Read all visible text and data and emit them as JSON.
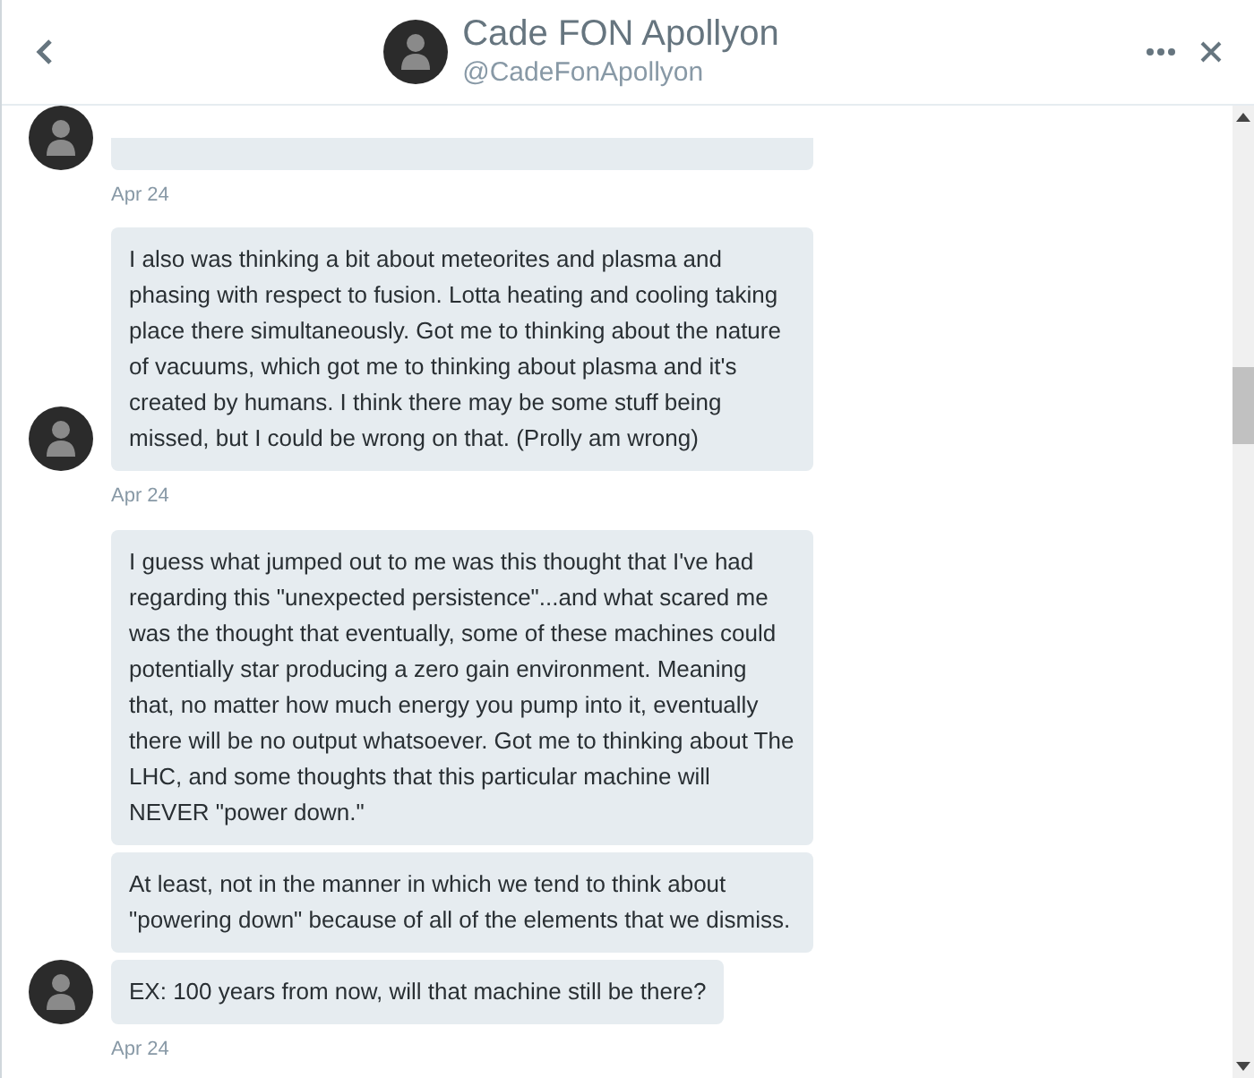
{
  "header": {
    "name": "Cade FON Apollyon",
    "handle": "@CadeFonApollyon"
  },
  "groups": [
    {
      "kind": "cut",
      "date": "Apr 24"
    },
    {
      "messages": [
        "I also was thinking a bit about meteorites and plasma and phasing with respect to fusion.  Lotta heating and cooling taking place there simultaneously. Got me to thinking about the nature of vacuums, which got me to thinking about plasma and it's created by humans. I think there may be some stuff being missed, but I could be wrong on that. (Prolly am wrong)"
      ],
      "date": "Apr 24"
    },
    {
      "messages": [
        "I guess what jumped out to me was this thought that I've had regarding this \"unexpected persistence\"...and what scared me was the thought that eventually, some of these machines could potentially star producing a zero gain environment. Meaning that, no matter how much energy you pump into it, eventually there will be no output whatsoever. Got me to thinking about The LHC, and some thoughts that this particular machine will NEVER \"power down.\"",
        "At least, not in the manner in which we tend to think about \"powering down\" because of all of the elements that we dismiss.",
        "EX: 100 years from now, will that machine still be there?"
      ],
      "date": "Apr 24"
    }
  ]
}
